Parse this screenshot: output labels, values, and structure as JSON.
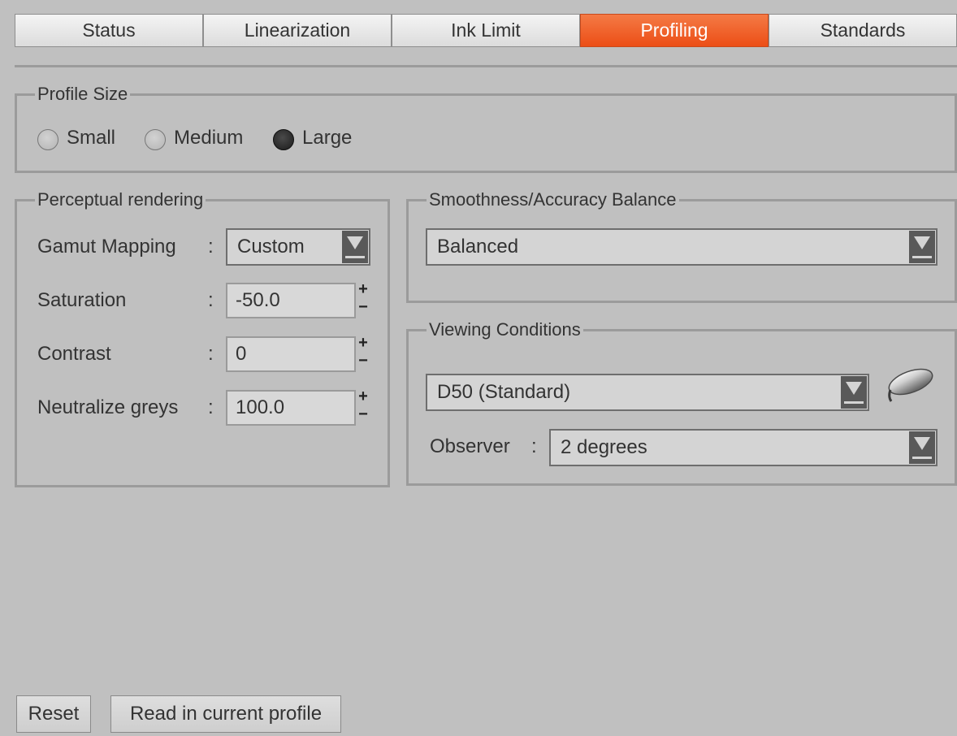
{
  "tabs": [
    {
      "label": "Status",
      "active": false
    },
    {
      "label": "Linearization",
      "active": false
    },
    {
      "label": "Ink Limit",
      "active": false
    },
    {
      "label": "Profiling",
      "active": true
    },
    {
      "label": "Standards",
      "active": false
    }
  ],
  "profile_size": {
    "title": "Profile Size",
    "options": [
      "Small",
      "Medium",
      "Large"
    ],
    "selected": "Large"
  },
  "perceptual": {
    "title": "Perceptual rendering",
    "gamut_mapping": {
      "label": "Gamut Mapping",
      "sep": ":",
      "value": "Custom"
    },
    "saturation": {
      "label": "Saturation",
      "sep": ":",
      "value": "-50.0"
    },
    "contrast": {
      "label": "Contrast",
      "sep": ":",
      "value": "0"
    },
    "neutralize": {
      "label": "Neutralize greys",
      "sep": ":",
      "value": "100.0"
    },
    "spin_up": "+",
    "spin_down": "−"
  },
  "smoothness": {
    "title": "Smoothness/Accuracy Balance",
    "value": "Balanced"
  },
  "viewing": {
    "title": "Viewing Conditions",
    "illuminant": "D50 (Standard)",
    "measure_icon": "measurement-device-icon",
    "observer": {
      "label": "Observer",
      "sep": ":",
      "value": "2 degrees"
    }
  },
  "buttons": {
    "reset": "Reset",
    "read_profile": "Read in current profile"
  },
  "colors": {
    "background": "#c0c0c0",
    "active_tab": "#ec4e16",
    "text": "#333333"
  }
}
